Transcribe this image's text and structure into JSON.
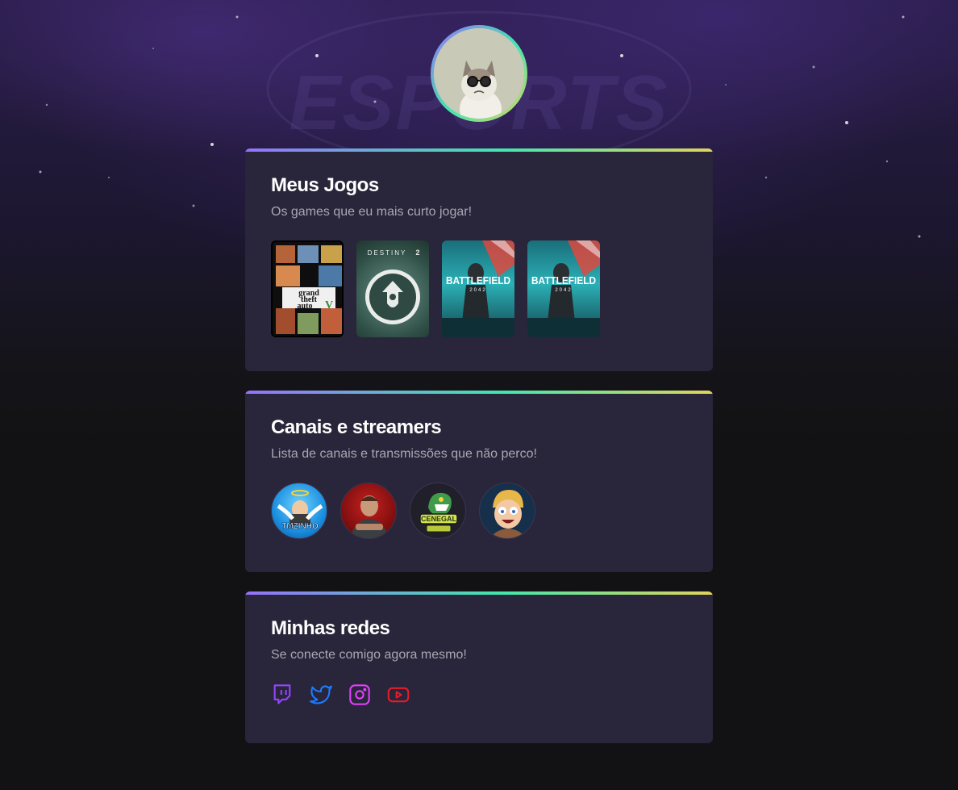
{
  "profile": {
    "avatar": "grumpy-cat-with-glasses"
  },
  "background": {
    "logo_text": "ESPORTS"
  },
  "games_card": {
    "title": "Meus Jogos",
    "subtitle": "Os games que eu mais curto jogar!",
    "games": [
      {
        "name": "Grand Theft Auto V",
        "cover_lines": [
          "grand",
          "theft",
          "auto"
        ],
        "badge": "V"
      },
      {
        "name": "Destiny 2",
        "cover_text": "DESTINY",
        "cover_num": "2"
      },
      {
        "name": "Battlefield 2042",
        "cover_text": "BATTLEFIELD",
        "cover_year": "2042"
      },
      {
        "name": "Battlefield 2042",
        "cover_text": "BATTLEFIELD",
        "cover_year": "2042"
      }
    ]
  },
  "streamers_card": {
    "title": "Canais e streamers",
    "subtitle": "Lista de canais e transmissões que não perco!",
    "streamers": [
      {
        "name": "Tmzinho",
        "label": "TMZINHO"
      },
      {
        "name": "streamer-2",
        "label": ""
      },
      {
        "name": "Cenegal Zanfas",
        "label": "CENEGAL"
      },
      {
        "name": "streamer-4",
        "label": ""
      }
    ]
  },
  "socials_card": {
    "title": "Minhas redes",
    "subtitle": "Se conecte comigo agora mesmo!",
    "links": [
      {
        "name": "twitch",
        "icon": "twitch-icon",
        "color": "#9147ff"
      },
      {
        "name": "twitter",
        "icon": "twitter-icon",
        "color": "#1d7bff"
      },
      {
        "name": "instagram",
        "icon": "instagram-icon",
        "color": "#e040fb"
      },
      {
        "name": "youtube",
        "icon": "youtube-icon",
        "color": "#e51c2b"
      }
    ]
  },
  "colors": {
    "card_bg": "#29253a",
    "page_bg": "#121214",
    "accent_gradient": [
      "#9572fc",
      "#43e7ad",
      "#e2d45c"
    ]
  }
}
